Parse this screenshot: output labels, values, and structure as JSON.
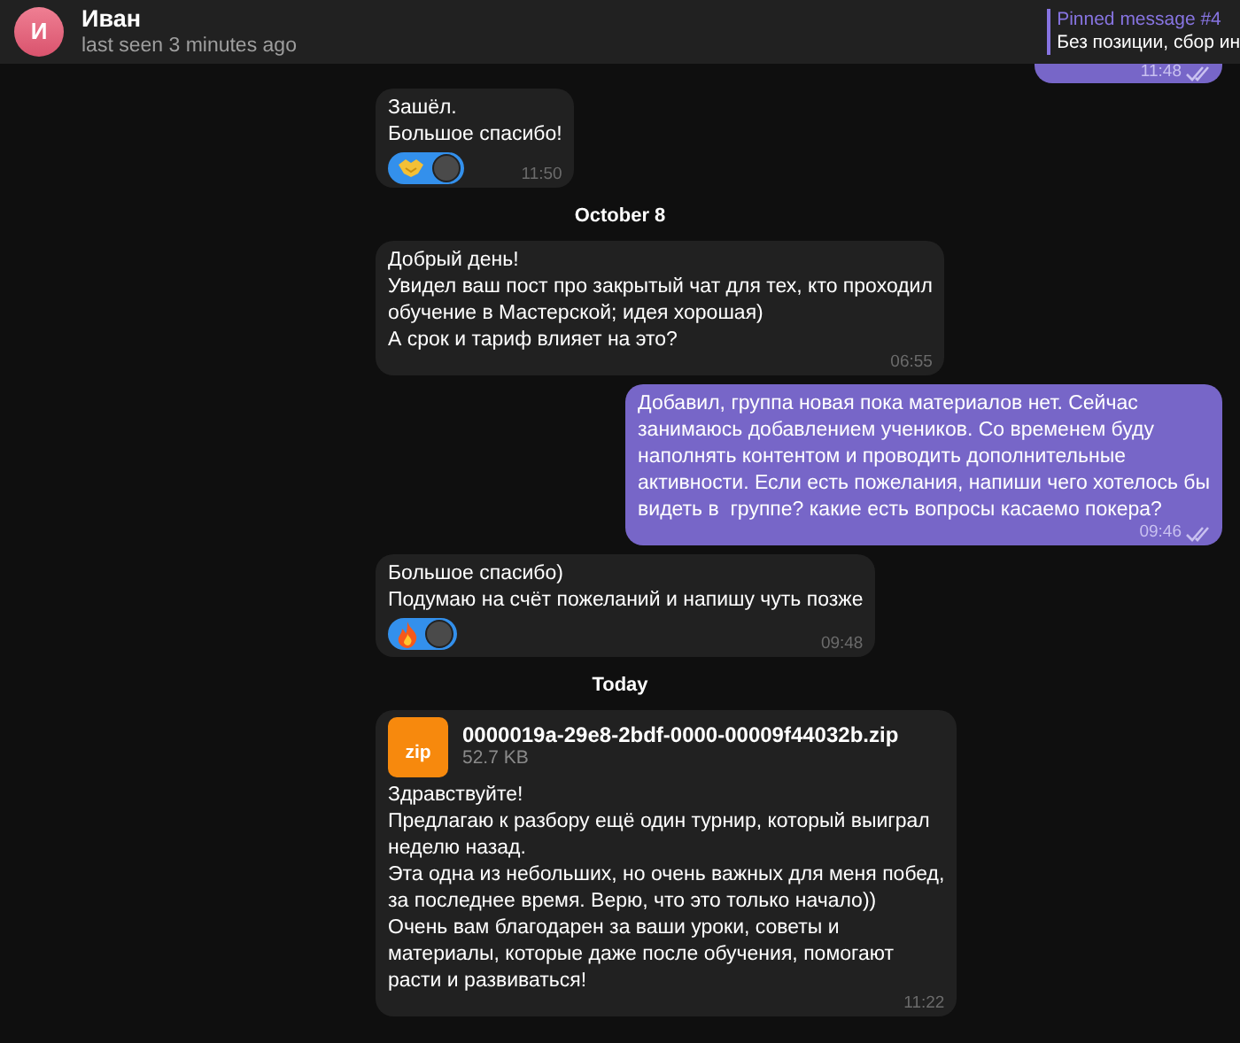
{
  "header": {
    "avatar_letter": "И",
    "name": "Иван",
    "status": "last seen 3 minutes ago",
    "pinned": {
      "title": "Pinned message #4",
      "text": "Без позиции, сбор ин"
    }
  },
  "messages": [
    {
      "kind": "message",
      "outgoing": true,
      "cut": true,
      "time": "11:48",
      "read": true
    },
    {
      "kind": "message",
      "outgoing": false,
      "text": "Зашёл.\nБольшое спасибо!",
      "reaction": {
        "kind": "handshake"
      },
      "time": "11:50"
    },
    {
      "kind": "date",
      "text": "October 8"
    },
    {
      "kind": "message",
      "outgoing": false,
      "text": "Добрый день!\nУвидел ваш пост про закрытый чат для тех, кто проходил\nобучение в Мастерской; идея хорошая)\nА срок и тариф влияет на это?",
      "time": "06:55"
    },
    {
      "kind": "message",
      "outgoing": true,
      "text": "Добавил, группа новая пока материалов нет. Сейчас\nзанимаюсь добавлением учеников. Со временем буду\nнаполнять контентом и проводить дополнительные\nактивности. Если есть пожелания, напиши чего хотелось бы\nвидеть в  группе? какие есть вопросы касаемо покера?",
      "time": "09:46",
      "read": true
    },
    {
      "kind": "message",
      "outgoing": false,
      "text": "Большое спасибо)\nПодумаю на счёт пожеланий и напишу чуть позже",
      "reaction": {
        "kind": "fire"
      },
      "time": "09:48"
    },
    {
      "kind": "date",
      "text": "Today"
    },
    {
      "kind": "message",
      "outgoing": false,
      "file": {
        "ext": "zip",
        "name": "0000019a-29e8-2bdf-0000-00009f44032b.zip",
        "size": "52.7 KB"
      },
      "text": "Здравствуйте!\nПредлагаю к разбору ещё один турнир, который выиграл\nнеделю назад.\nЭта одна из небольших, но очень важных для меня побед,\nза последнее время. Верю, что это только начало))\nОчень вам благодарен за ваши уроки, советы и\nматериалы, которые даже после обучения, помогают\nрасти и развиваться!",
      "time": "11:22"
    }
  ]
}
